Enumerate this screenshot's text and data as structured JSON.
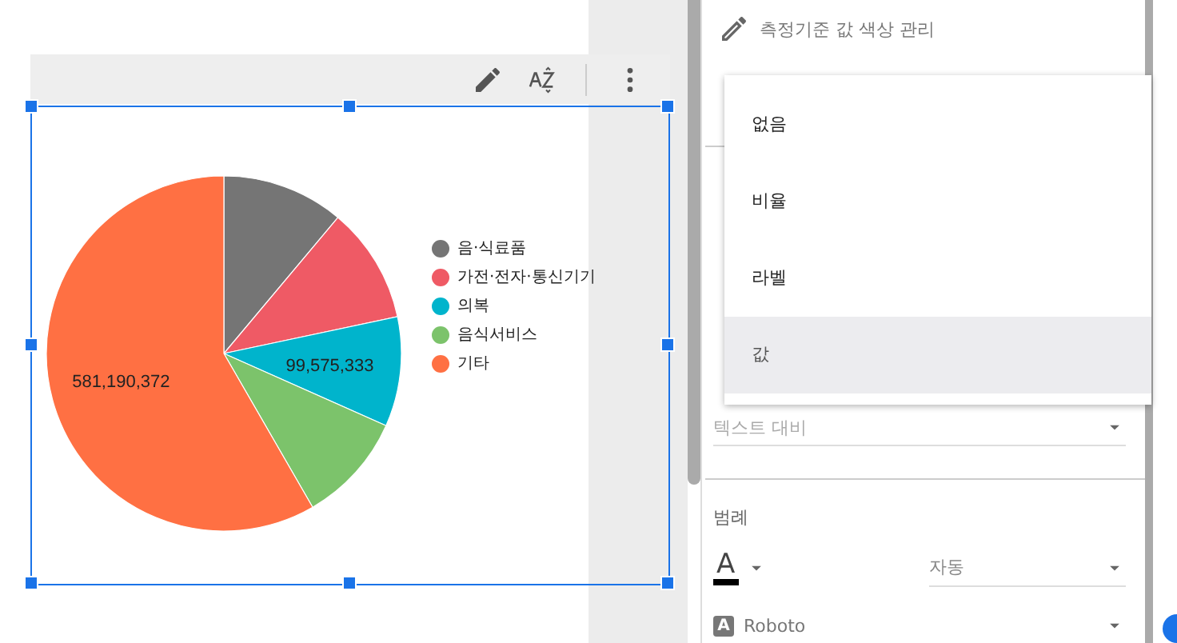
{
  "toolbar": {
    "buttons": [
      {
        "kind": "edit"
      },
      {
        "kind": "sort"
      },
      {
        "kind": "divider"
      },
      {
        "kind": "more"
      }
    ]
  },
  "chart": {
    "chart_data": {
      "type": "pie",
      "categories": [
        "음·식료품",
        "가전·전자·통신기기",
        "의복",
        "음식서비스",
        "기타"
      ],
      "colors": [
        "#757575",
        "#ef5a65",
        "#00b4cc",
        "#7cc36b",
        "#ff7043"
      ],
      "values": [
        110700000,
        105170000,
        99575333,
        99630000,
        581190372
      ],
      "legend": "right",
      "value_labels": [
        null,
        null,
        "99,575,333",
        null,
        "581,190,372"
      ]
    }
  },
  "panel": {
    "header": "측정기준 값 색상 관리",
    "menu": [
      {
        "label": "없음",
        "selected": false
      },
      {
        "label": "비율",
        "selected": false
      },
      {
        "label": "라벨",
        "selected": false
      },
      {
        "label": "값",
        "selected": true
      }
    ],
    "contrast_field": {
      "placeholder": "텍스트 대비"
    },
    "legend_title": "범례",
    "text_color_button": {
      "label": "A"
    },
    "size_select": {
      "value": "자동"
    },
    "font_select": {
      "icon_letter": "A",
      "value": "Roboto"
    }
  }
}
